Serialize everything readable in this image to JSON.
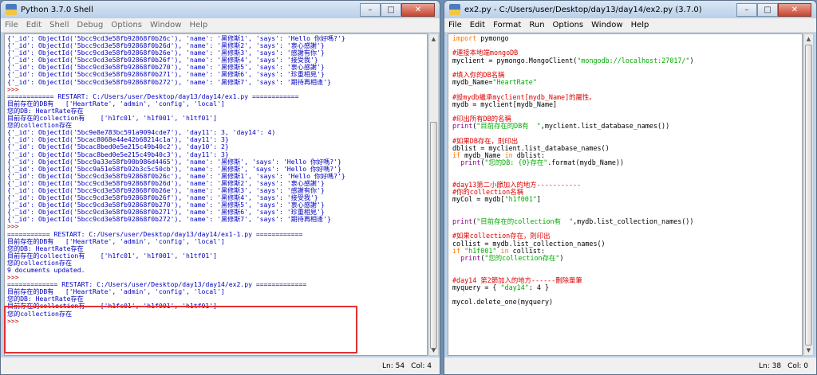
{
  "shell": {
    "title": "Python 3.7.0 Shell",
    "menu": [
      "File",
      "Edit",
      "Shell",
      "Debug",
      "Options",
      "Window",
      "Help"
    ],
    "lines": [
      {
        "c": "blue",
        "t": "{'_id': ObjectId('5bcc9cd3e58fb92868f0b26c'), 'name': '黑修斯1', 'says': 'Hello 你好嗎?'}"
      },
      {
        "c": "blue",
        "t": "{'_id': ObjectId('5bcc9cd3e58fb92868f0b26d'), 'name': '黑修斯2', 'says': '衷心感謝'}"
      },
      {
        "c": "blue",
        "t": "{'_id': ObjectId('5bcc9cd3e58fb92868f0b26e'), 'name': '黑修斯3', 'says': '感謝有你'}"
      },
      {
        "c": "blue",
        "t": "{'_id': ObjectId('5bcc9cd3e58fb92868f0b26f'), 'name': '黑修斯4', 'says': '接受我'}"
      },
      {
        "c": "blue",
        "t": "{'_id': ObjectId('5bcc9cd3e58fb92868f0b270'), 'name': '黑修斯5', 'says': '衷心感謝'}"
      },
      {
        "c": "blue",
        "t": "{'_id': ObjectId('5bcc9cd3e58fb92868f0b271'), 'name': '黑修斯6', 'says': '珍重相見'}"
      },
      {
        "c": "blue",
        "t": "{'_id': ObjectId('5bcc9cd3e58fb92868f0b272'), 'name': '黑修斯7', 'says': '期待再相逢'}"
      },
      {
        "c": "red",
        "t": ">>> "
      },
      {
        "c": "blue",
        "t": "============ RESTART: C:/Users/user/Desktop/day13/day14/ex1.py ============"
      },
      {
        "c": "blue",
        "t": "目前存在的DB有   ['HeartRate', 'admin', 'config', 'local']"
      },
      {
        "c": "blue",
        "t": "您的DB: HeartRate存在"
      },
      {
        "c": "blue",
        "t": "目前存在的collection有    ['h1fc01', 'h1f001', 'h1tf01']"
      },
      {
        "c": "blue",
        "t": "您的collection存在"
      },
      {
        "c": "blue",
        "t": "{'_id': ObjectId('5bc9e8e783bc591a9094cde7'), 'day11': 3, 'day14': 4)"
      },
      {
        "c": "blue",
        "t": "{'_id': ObjectId('5bcac8068e44e42b68214c1a'), 'day11': 3}"
      },
      {
        "c": "blue",
        "t": "{'_id': ObjectId('5bcac8bed0e5e215c49b40c2'), 'day10': 2}"
      },
      {
        "c": "blue",
        "t": "{'_id': ObjectId('5bcac8bed0e5e215c49b40c3'), 'day11': 3}"
      },
      {
        "c": "blue",
        "t": "{'_id': ObjectId('5bcc9a33e58fb90b986d4465'), 'name': '黑修斯', 'says': 'Hello 你好嗎?'}"
      },
      {
        "c": "blue",
        "t": "{'_id': ObjectId('5bcc9a51e58fb92b3c5c50cb'), 'name': '黑修斯', 'says': 'Hello 你好嗎?'}"
      },
      {
        "c": "blue",
        "t": "{'_id': ObjectId('5bcc9cd3e58fb92868f0b26c'), 'name': '黑修斯1', 'says': 'Hello 你好嗎?'}"
      },
      {
        "c": "blue",
        "t": "{'_id': ObjectId('5bcc9cd3e58fb92868f0b26d'), 'name': '黑修斯2', 'says': '衷心感謝'}"
      },
      {
        "c": "blue",
        "t": "{'_id': ObjectId('5bcc9cd3e58fb92868f0b26e'), 'name': '黑修斯3', 'says': '感謝有你'}"
      },
      {
        "c": "blue",
        "t": "{'_id': ObjectId('5bcc9cd3e58fb92868f0b26f'), 'name': '黑修斯4', 'says': '接受我'}"
      },
      {
        "c": "blue",
        "t": "{'_id': ObjectId('5bcc9cd3e58fb92868f0b270'), 'name': '黑修斯5', 'says': '衷心感謝'}"
      },
      {
        "c": "blue",
        "t": "{'_id': ObjectId('5bcc9cd3e58fb92868f0b271'), 'name': '黑修斯6', 'says': '珍重相見'}"
      },
      {
        "c": "blue",
        "t": "{'_id': ObjectId('5bcc9cd3e58fb92868f0b272'), 'name': '黑修斯7', 'says': '期待再相逢'}"
      },
      {
        "c": "red",
        "t": ">>> "
      },
      {
        "c": "blue",
        "t": "=========== RESTART: C:/Users/user/Desktop/day13/day14/ex1-1.py ============"
      },
      {
        "c": "blue",
        "t": "目前存在的DB有   ['HeartRate', 'admin', 'config', 'local']"
      },
      {
        "c": "blue",
        "t": "您的DB: HeartRate存在"
      },
      {
        "c": "blue",
        "t": "目前存在的collection有    ['h1fc01', 'h1f001', 'h1tf01']"
      },
      {
        "c": "blue",
        "t": "您的collection存在"
      },
      {
        "c": "blue",
        "t": "9 documents updated."
      },
      {
        "c": "red",
        "t": ">>> "
      },
      {
        "c": "blue",
        "t": "============= RESTART: C:/Users/user/Desktop/day13/day14/ex2.py ============="
      },
      {
        "c": "blue",
        "t": "目前存在的DB有   ['HeartRate', 'admin', 'config', 'local']"
      },
      {
        "c": "blue",
        "t": "您的DB: HeartRate存在"
      },
      {
        "c": "blue",
        "t": "目前存在的collection有    ['h1fc01', 'h1f001', 'h1tf01']"
      },
      {
        "c": "blue",
        "t": "您的collection存在"
      },
      {
        "c": "red",
        "t": ">>> "
      }
    ],
    "status": {
      "ln": "Ln: 54",
      "col": "Col: 4"
    }
  },
  "editor": {
    "title": "ex2.py - C:/Users/user/Desktop/day13/day14/ex2.py (3.7.0)",
    "menu": [
      "File",
      "Edit",
      "Format",
      "Run",
      "Options",
      "Window",
      "Help"
    ],
    "lines": [
      [
        {
          "c": "k",
          "t": "import"
        },
        {
          "c": "n",
          "t": " pymongo"
        }
      ],
      [
        {
          "c": "n",
          "t": ""
        }
      ],
      [
        {
          "c": "c",
          "t": "#連接本地端mongoDB"
        }
      ],
      [
        {
          "c": "n",
          "t": "myclient = pymongo.MongoClient("
        },
        {
          "c": "s",
          "t": "\"mongodb://localhost:27017/\""
        },
        {
          "c": "n",
          "t": ")"
        }
      ],
      [
        {
          "c": "n",
          "t": ""
        }
      ],
      [
        {
          "c": "c",
          "t": "#填入你的DB名稱"
        }
      ],
      [
        {
          "c": "n",
          "t": "mydb_Name="
        },
        {
          "c": "s",
          "t": "\"HeartRate\""
        }
      ],
      [
        {
          "c": "n",
          "t": ""
        }
      ],
      [
        {
          "c": "c",
          "t": "#設mydb繼承myclient[mydb_Name]的屬性。"
        }
      ],
      [
        {
          "c": "n",
          "t": "mydb = myclient[mydb_Name]"
        }
      ],
      [
        {
          "c": "n",
          "t": ""
        }
      ],
      [
        {
          "c": "c",
          "t": "#印出所有DB的名稱"
        }
      ],
      [
        {
          "c": "b",
          "t": "print"
        },
        {
          "c": "n",
          "t": "("
        },
        {
          "c": "s",
          "t": "\"目前存在的DB有  \""
        },
        {
          "c": "n",
          "t": ",myclient.list_database_names())"
        }
      ],
      [
        {
          "c": "n",
          "t": ""
        }
      ],
      [
        {
          "c": "c",
          "t": "#如果DB存在，則印出"
        }
      ],
      [
        {
          "c": "n",
          "t": "dblist = myclient.list_database_names()"
        }
      ],
      [
        {
          "c": "k",
          "t": "if"
        },
        {
          "c": "n",
          "t": " mydb_Name "
        },
        {
          "c": "k",
          "t": "in"
        },
        {
          "c": "n",
          "t": " dblist:"
        }
      ],
      [
        {
          "c": "n",
          "t": "  "
        },
        {
          "c": "b",
          "t": "print"
        },
        {
          "c": "n",
          "t": "("
        },
        {
          "c": "s",
          "t": "\"您的DB: {0}存在\""
        },
        {
          "c": "n",
          "t": ".format(mydb_Name))"
        }
      ],
      [
        {
          "c": "n",
          "t": ""
        }
      ],
      [
        {
          "c": "n",
          "t": ""
        }
      ],
      [
        {
          "c": "c",
          "t": "#day13第二小節加入的地方-----------"
        }
      ],
      [
        {
          "c": "c",
          "t": "#你的collection名稱"
        }
      ],
      [
        {
          "c": "n",
          "t": "myCol = mydb["
        },
        {
          "c": "s",
          "t": "\"h1f001\""
        },
        {
          "c": "n",
          "t": "]"
        }
      ],
      [
        {
          "c": "n",
          "t": ""
        }
      ],
      [
        {
          "c": "n",
          "t": ""
        }
      ],
      [
        {
          "c": "b",
          "t": "print"
        },
        {
          "c": "n",
          "t": "("
        },
        {
          "c": "s",
          "t": "\"目前存在的collection有  \""
        },
        {
          "c": "n",
          "t": ",mydb.list_collection_names())"
        }
      ],
      [
        {
          "c": "n",
          "t": ""
        }
      ],
      [
        {
          "c": "c",
          "t": "#如果collection存在，則印出"
        }
      ],
      [
        {
          "c": "n",
          "t": "collist = mydb.list_collection_names()"
        }
      ],
      [
        {
          "c": "k",
          "t": "if"
        },
        {
          "c": "n",
          "t": " "
        },
        {
          "c": "s",
          "t": "\"h1f001\""
        },
        {
          "c": "n",
          "t": " "
        },
        {
          "c": "k",
          "t": "in"
        },
        {
          "c": "n",
          "t": " collist:"
        }
      ],
      [
        {
          "c": "n",
          "t": "  "
        },
        {
          "c": "b",
          "t": "print"
        },
        {
          "c": "n",
          "t": "("
        },
        {
          "c": "s",
          "t": "\"您的collection存在\""
        },
        {
          "c": "n",
          "t": ")"
        }
      ],
      [
        {
          "c": "n",
          "t": ""
        }
      ],
      [
        {
          "c": "n",
          "t": ""
        }
      ],
      [
        {
          "c": "c",
          "t": "#day14 第2節加入的地方------刪除單筆"
        }
      ],
      [
        {
          "c": "n",
          "t": "myquery = { "
        },
        {
          "c": "s",
          "t": "\"day14\""
        },
        {
          "c": "n",
          "t": ": 4 }"
        }
      ],
      [
        {
          "c": "n",
          "t": ""
        }
      ],
      [
        {
          "c": "n",
          "t": "mycol.delete_one(myquery)"
        }
      ]
    ],
    "status": {
      "ln": "Ln: 38",
      "col": "Col: 0"
    }
  },
  "controls": {
    "minimize": "–",
    "maximize": "□",
    "close": "✕"
  },
  "scroll": {
    "up": "▲",
    "down": "▼"
  }
}
